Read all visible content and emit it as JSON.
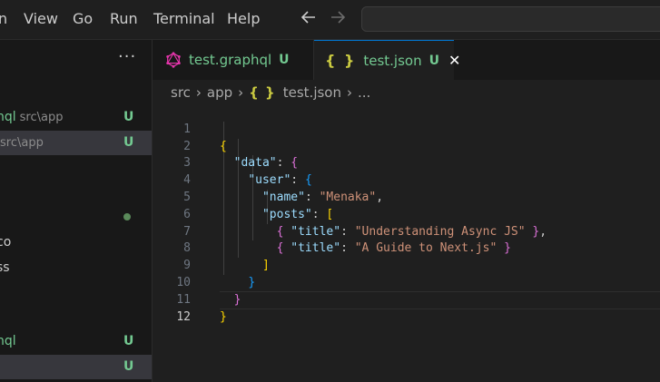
{
  "menu": {
    "items": [
      "n",
      "View",
      "Go",
      "Run",
      "Terminal",
      "Help"
    ]
  },
  "nav": {
    "back_icon": "arrow-left-icon",
    "forward_icon": "arrow-right-icon"
  },
  "search": {
    "placeholder": ""
  },
  "sidebar": {
    "more_label": "···",
    "rows": [
      {
        "name": "hql",
        "path": "src\\app",
        "status": "U"
      },
      {
        "name": "",
        "path": "src\\app",
        "status": "U"
      },
      {
        "name": "co"
      },
      {
        "name": "ss"
      },
      {
        "name": "hql",
        "status": "U"
      },
      {
        "status": "U"
      }
    ]
  },
  "tabs": [
    {
      "label": "test.graphql",
      "status": "U",
      "icon": "graphql-icon"
    },
    {
      "label": "test.json",
      "status": "U",
      "icon": "json-braces-icon",
      "close": "✕"
    }
  ],
  "breadcrumb": {
    "items": [
      "src",
      "app",
      "test.json",
      "..."
    ],
    "icon": "{ }",
    "separator": "›"
  },
  "editor": {
    "line_numbers": [
      "1",
      "2",
      "3",
      "4",
      "5",
      "6",
      "7",
      "8",
      "9",
      "10",
      "11",
      "12"
    ],
    "tokens": {
      "data_key": "\"data\"",
      "user_key": "\"user\"",
      "name_key": "\"name\"",
      "name_value": "\"Menaka\"",
      "posts_key": "\"posts\"",
      "title_key": "\"title\"",
      "title_value_1": "\"Understanding Async JS\"",
      "title_value_2": "\"A Guide to Next.js\""
    }
  },
  "colors": {
    "accent": "#0078d4",
    "untracked_green": "#73c991",
    "json_key": "#9cdcfe",
    "json_string": "#ce9178",
    "bracket_gold": "#ffd700",
    "bracket_purple": "#da70d6",
    "bracket_blue": "#179fff"
  }
}
